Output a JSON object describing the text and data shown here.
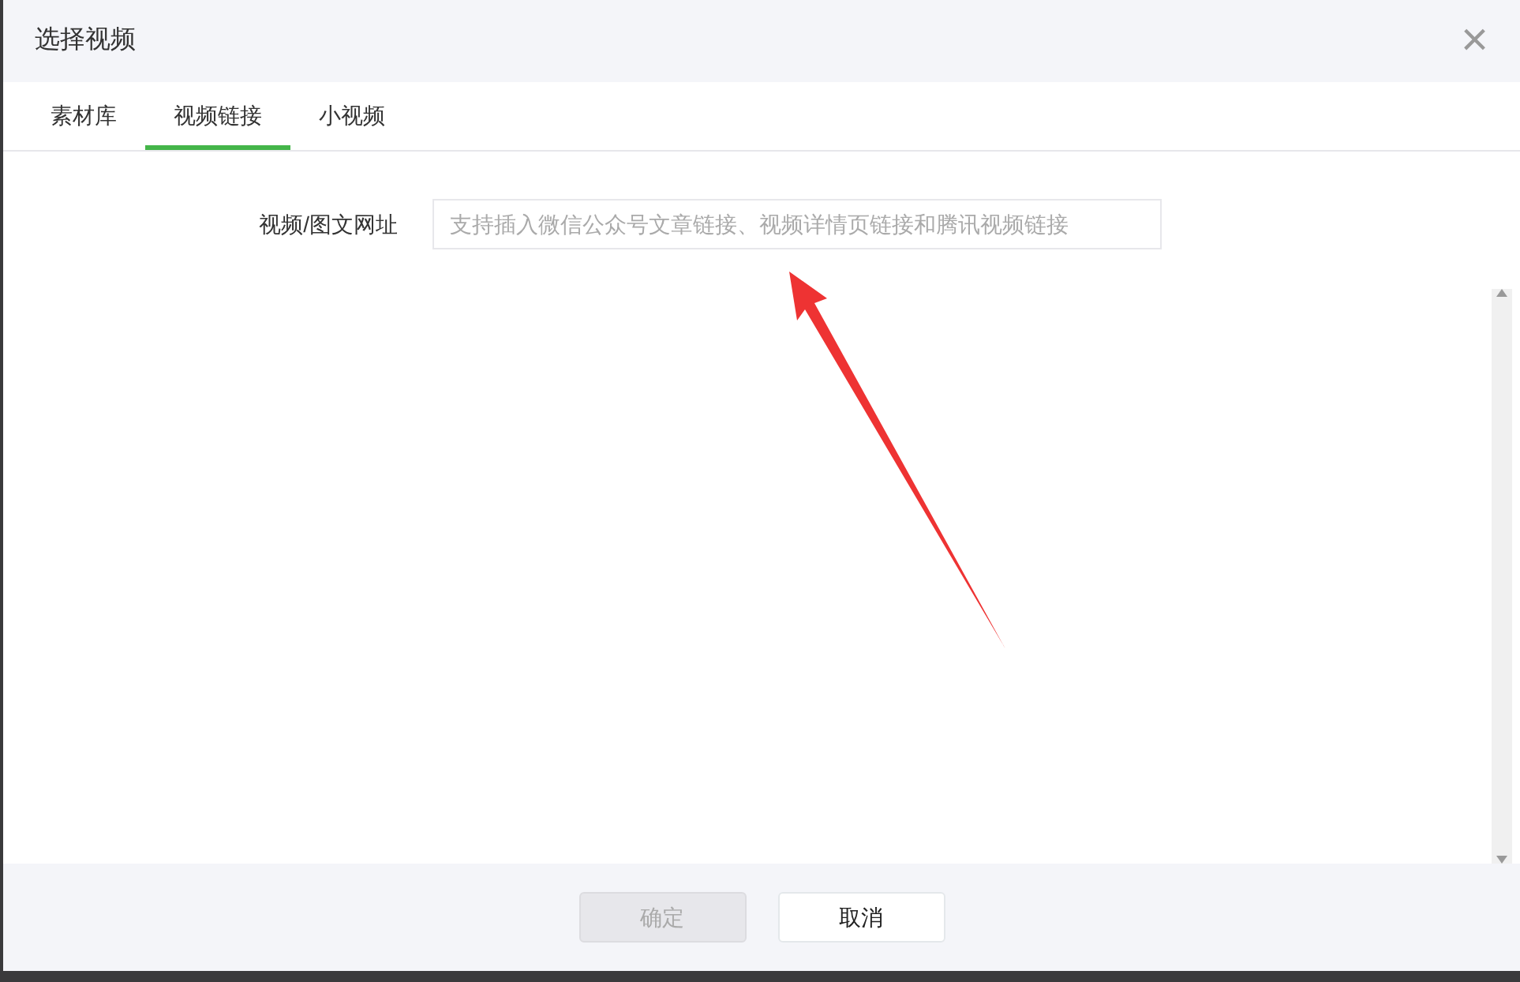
{
  "dialog": {
    "title": "选择视频",
    "close": "×"
  },
  "tabs": [
    {
      "label": "素材库",
      "selected": false
    },
    {
      "label": "视频链接",
      "selected": true
    },
    {
      "label": "小视频",
      "selected": false
    }
  ],
  "form": {
    "label": "视频/图文网址",
    "placeholder": "支持插入微信公众号文章链接、视频详情页链接和腾讯视频链接"
  },
  "buttons": [
    {
      "label": "确定",
      "disabled": true
    },
    {
      "label": "取消",
      "disabled": false
    }
  ]
}
